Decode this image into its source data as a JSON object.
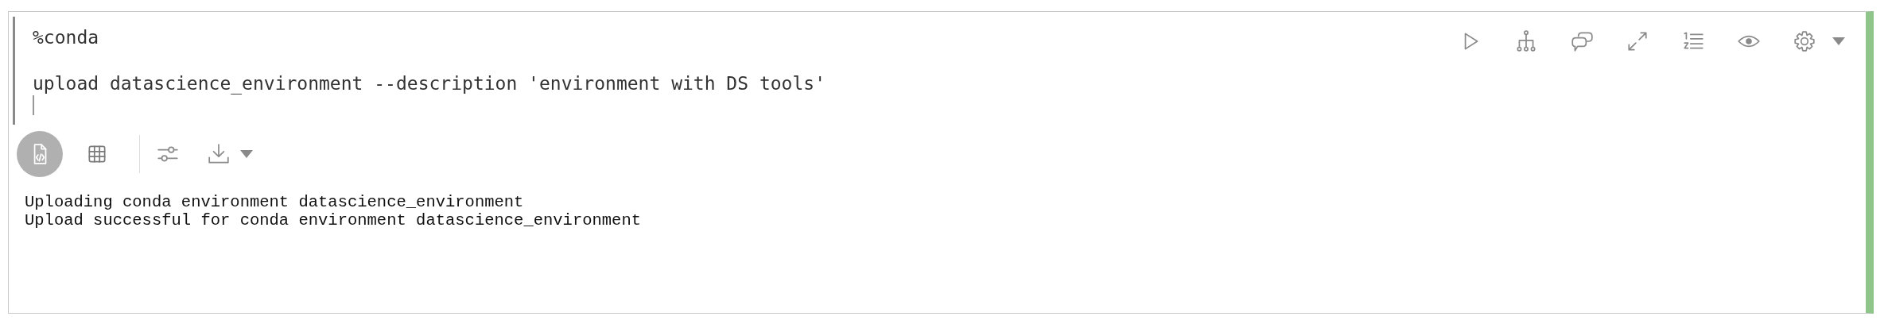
{
  "cell": {
    "succeeded": true,
    "code": "%conda\n\nupload datascience_environment --description 'environment with DS tools'",
    "output_views": [
      {
        "kind": "code",
        "selected": true
      },
      {
        "kind": "table",
        "selected": false
      }
    ],
    "output_lines": [
      "Uploading conda environment datascience_environment",
      "Upload successful for conda environment datascience_environment"
    ]
  }
}
